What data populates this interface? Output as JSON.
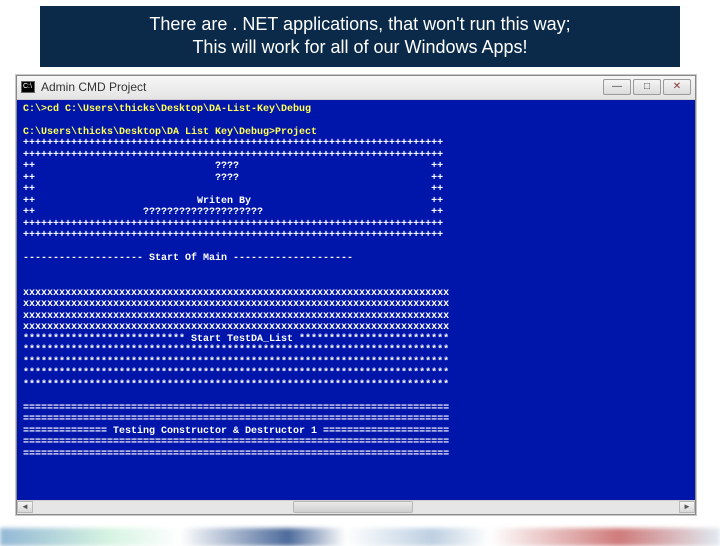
{
  "caption": {
    "line1": "There are . NET applications, that won't run this way;",
    "line2": "This will work for all of our Windows Apps!"
  },
  "window": {
    "title": "Admin  CMD   Project",
    "buttons": {
      "min": "—",
      "max": "□",
      "close": "✕"
    }
  },
  "console": {
    "line01": "C:\\>cd C:\\Users\\thicks\\Desktop\\DA-List-Key\\Debug",
    "blank1": " ",
    "line02": "C:\\Users\\thicks\\Desktop\\DA List Key\\Debug>Project",
    "plus01": "++++++++++++++++++++++++++++++++++++++++++++++++++++++++++++++++++++++",
    "plus02": "++++++++++++++++++++++++++++++++++++++++++++++++++++++++++++++++++++++",
    "plus03": "++                              ????                                ++",
    "plus04": "++                              ????                                ++",
    "plus05": "++                                                                  ++",
    "plus06": "++                           Writen By                              ++",
    "plus07": "++                  ????????????????????                            ++",
    "plus08": "++++++++++++++++++++++++++++++++++++++++++++++++++++++++++++++++++++++",
    "plus09": "++++++++++++++++++++++++++++++++++++++++++++++++++++++++++++++++++++++",
    "blank2": " ",
    "startm": "-------------------- Start Of Main --------------------",
    "blank3": " ",
    "blank4": " ",
    "xrow01": "xxxxxxxxxxxxxxxxxxxxxxxxxxxxxxxxxxxxxxxxxxxxxxxxxxxxxxxxxxxxxxxxxxxxxxx",
    "xrow02": "xxxxxxxxxxxxxxxxxxxxxxxxxxxxxxxxxxxxxxxxxxxxxxxxxxxxxxxxxxxxxxxxxxxxxxx",
    "xrow03": "xxxxxxxxxxxxxxxxxxxxxxxxxxxxxxxxxxxxxxxxxxxxxxxxxxxxxxxxxxxxxxxxxxxxxxx",
    "xrow04": "xxxxxxxxxxxxxxxxxxxxxxxxxxxxxxxxxxxxxxxxxxxxxxxxxxxxxxxxxxxxxxxxxxxxxxx",
    "star01": "*************************** Start TestDA_List *************************",
    "star02": "***********************************************************************",
    "star03": "***********************************************************************",
    "star04": "***********************************************************************",
    "star05": "***********************************************************************",
    "blank5": " ",
    "eq01": "=======================================================================",
    "eq02": "=======================================================================",
    "eq03": "============== Testing Constructor & Destructor 1 =====================",
    "eq04": "=======================================================================",
    "eq05": "======================================================================="
  }
}
